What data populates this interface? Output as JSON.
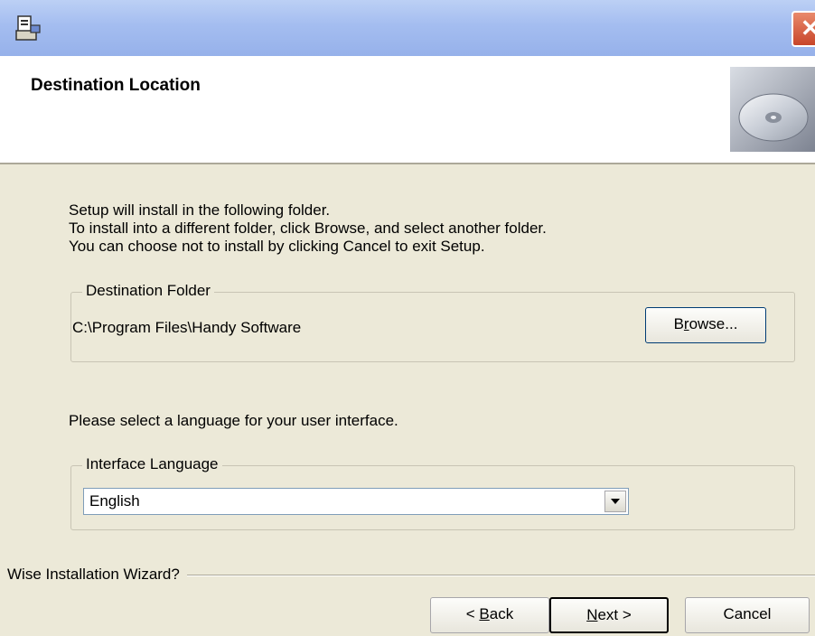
{
  "header": {
    "title": "Destination Location"
  },
  "intro": {
    "line1": "Setup will install  in the following folder.",
    "line2": "To install into a different folder, click Browse, and select another folder.",
    "line3": "You can choose not to install  by clicking Cancel to exit Setup."
  },
  "destination": {
    "group_label": "Destination Folder",
    "path": "C:\\Program Files\\Handy Software",
    "browse_pre": "B",
    "browse_u": "r",
    "browse_post": "owse..."
  },
  "language": {
    "prompt": "Please select a language for your user interface.",
    "group_label": "Interface Language",
    "selected": "English"
  },
  "footer": {
    "wizard_label": "Wise Installation Wizard?",
    "back_pre": "< ",
    "back_u": "B",
    "back_post": "ack",
    "next_u": "N",
    "next_post": "ext >",
    "cancel_label": "Cancel"
  },
  "icons": {
    "app": "installer-icon",
    "close": "close-icon",
    "header": "cd-disc-icon",
    "dropdown": "chevron-down-icon"
  },
  "colors": {
    "window_bg": "#ece9d8",
    "titlebar": "#a4bdf0",
    "close": "#c8452a"
  }
}
